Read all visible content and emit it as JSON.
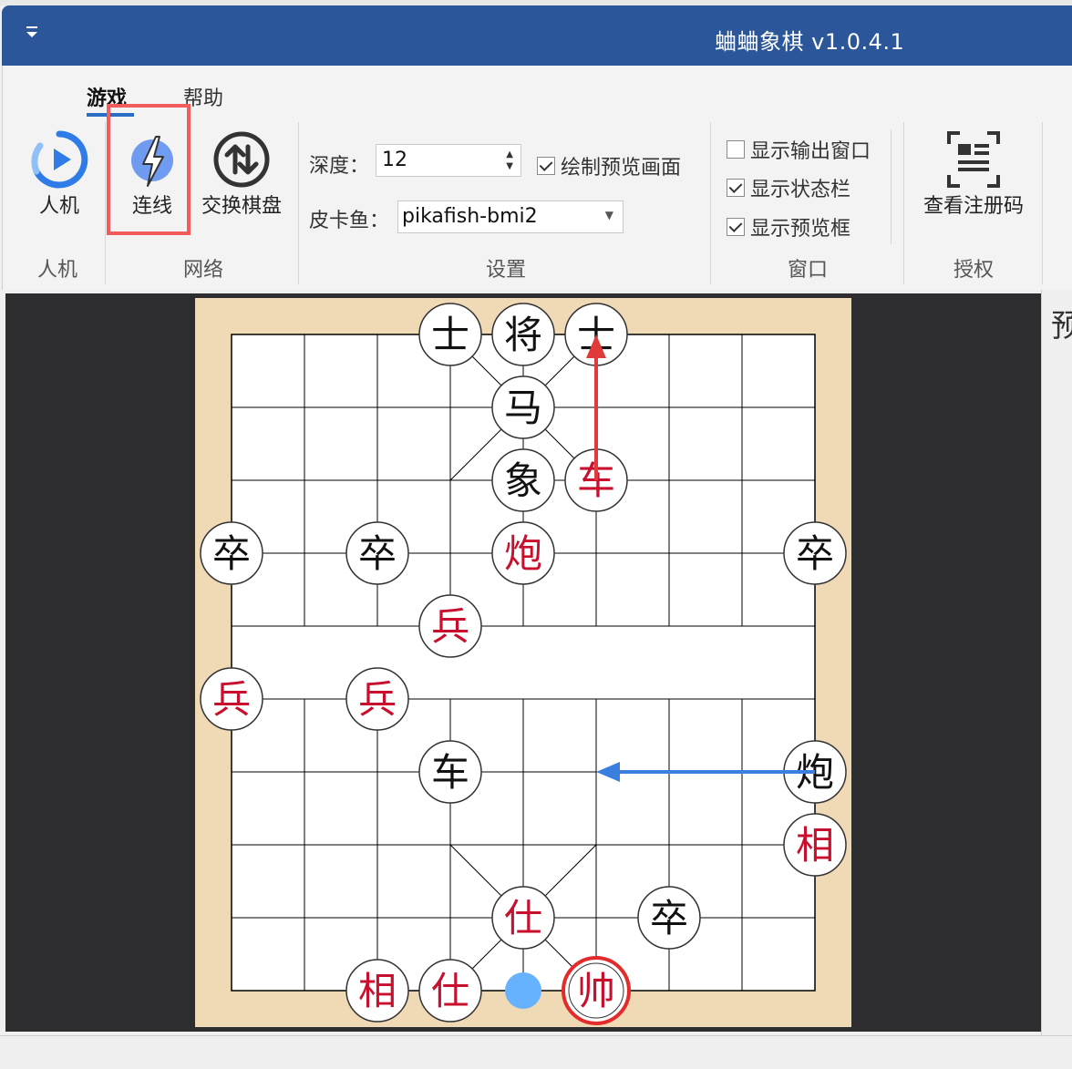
{
  "window": {
    "title": "蛐蛐象棋 v1.0.4.1"
  },
  "tabs": [
    {
      "label": "游戏",
      "active": true
    },
    {
      "label": "帮助",
      "active": false
    }
  ],
  "ribbon": {
    "human": {
      "button": "人机",
      "group": "人机"
    },
    "network": {
      "connect": "连线",
      "swap": "交换棋盘",
      "group": "网络"
    },
    "settings": {
      "depth_label": "深度：",
      "depth_value": "12",
      "draw_preview_label": "绘制预览画面",
      "draw_preview_checked": true,
      "engine_label": "皮卡鱼：",
      "engine_value": "pikafish-bmi2",
      "group": "设置"
    },
    "window": {
      "show_output": {
        "label": "显示输出窗口",
        "checked": false
      },
      "show_status": {
        "label": "显示状态栏",
        "checked": true
      },
      "show_preview": {
        "label": "显示预览框",
        "checked": true
      },
      "group": "窗口"
    },
    "license": {
      "button": "查看注册码",
      "group": "授权"
    }
  },
  "side_panel": {
    "header": "预"
  },
  "board": {
    "river": [
      "",
      ""
    ],
    "pieces": [
      {
        "c": 3,
        "r": 0,
        "t": "士",
        "side": "black"
      },
      {
        "c": 4,
        "r": 0,
        "t": "将",
        "side": "black"
      },
      {
        "c": 5,
        "r": 0,
        "t": "士",
        "side": "black"
      },
      {
        "c": 4,
        "r": 1,
        "t": "马",
        "side": "black"
      },
      {
        "c": 4,
        "r": 2,
        "t": "象",
        "side": "black"
      },
      {
        "c": 5,
        "r": 2,
        "t": "车",
        "side": "red"
      },
      {
        "c": 0,
        "r": 3,
        "t": "卒",
        "side": "black"
      },
      {
        "c": 2,
        "r": 3,
        "t": "卒",
        "side": "black"
      },
      {
        "c": 4,
        "r": 3,
        "t": "炮",
        "side": "red"
      },
      {
        "c": 8,
        "r": 3,
        "t": "卒",
        "side": "black"
      },
      {
        "c": 3,
        "r": 4,
        "t": "兵",
        "side": "red"
      },
      {
        "c": 0,
        "r": 5,
        "t": "兵",
        "side": "red"
      },
      {
        "c": 2,
        "r": 5,
        "t": "兵",
        "side": "red"
      },
      {
        "c": 3,
        "r": 6,
        "t": "车",
        "side": "black"
      },
      {
        "c": 8,
        "r": 6,
        "t": "炮",
        "side": "black"
      },
      {
        "c": 8,
        "r": 7,
        "t": "相",
        "side": "red"
      },
      {
        "c": 4,
        "r": 8,
        "t": "仕",
        "side": "red"
      },
      {
        "c": 6,
        "r": 8,
        "t": "卒",
        "side": "black"
      },
      {
        "c": 2,
        "r": 9,
        "t": "相",
        "side": "red"
      },
      {
        "c": 3,
        "r": 9,
        "t": "仕",
        "side": "red"
      },
      {
        "c": 5,
        "r": 9,
        "t": "帅",
        "side": "red",
        "selected": true
      }
    ],
    "move_marker": {
      "c": 4,
      "r": 9
    },
    "arrows": [
      {
        "from": [
          5,
          2
        ],
        "to": [
          5,
          0
        ],
        "color": "#e03a3a"
      },
      {
        "from": [
          8,
          6
        ],
        "to": [
          5,
          6
        ],
        "color": "#3a7ee0"
      }
    ],
    "colors": {
      "wood": "#f0d9b5",
      "red": "#c8102e",
      "black": "#111111",
      "select": "#e32b2b",
      "marker": "#66b2ff"
    }
  }
}
